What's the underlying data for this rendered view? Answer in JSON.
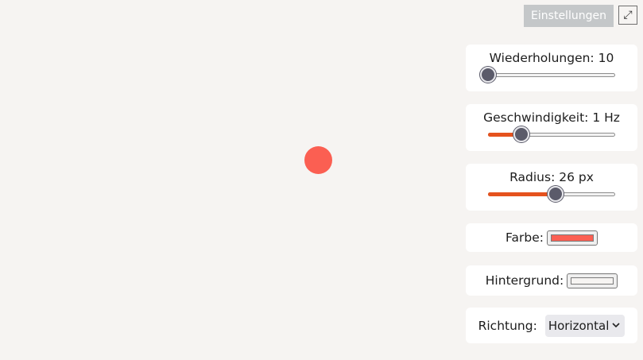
{
  "toolbar": {
    "settings_label": "Einstellungen",
    "fullscreen_icon": "⤢"
  },
  "stage": {
    "ball_color": "#fb5f52"
  },
  "controls": {
    "repetitions": {
      "label": "Wiederholungen: 10",
      "value": 10,
      "fill_fraction": 0.0
    },
    "speed": {
      "label": "Geschwindigkeit: 1 Hz",
      "value": 1,
      "fill_fraction": 0.26
    },
    "radius": {
      "label": "Radius: 26 px",
      "value": 26,
      "fill_fraction": 0.53
    },
    "color": {
      "label": "Farbe:",
      "value": "#fb5f52"
    },
    "background": {
      "label": "Hintergrund:",
      "value": "#f6f4f2"
    },
    "direction": {
      "label": "Richtung:",
      "selected": "Horizontal"
    }
  },
  "colors": {
    "accent": "#e5521e",
    "thumb": "#5b5b6a",
    "settings_button": "#c4c7c9"
  }
}
